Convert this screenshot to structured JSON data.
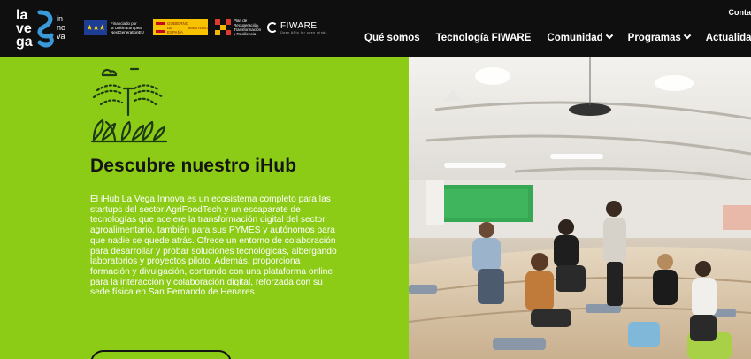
{
  "brand": {
    "logo_words": [
      "la",
      "ve",
      "ga"
    ],
    "logo_small": [
      "in",
      "no",
      "va"
    ]
  },
  "sponsors": {
    "eu_text": [
      "Financiado por",
      "la Unión Europea",
      "NextGenerationEU"
    ],
    "gov_text": "GOBIERNO DE ESPAÑA",
    "ministry_text": "MINISTERIO",
    "prtr_text": [
      "Plan de",
      "Recuperación,",
      "Transformación",
      "y Resiliencia"
    ],
    "fiware_text": "FIWARE",
    "fiware_sub": "Open APIs for open minds"
  },
  "header": {
    "contact": "Conta",
    "nav": [
      {
        "label": "Qué somos",
        "dropdown": false
      },
      {
        "label": "Tecnología FIWARE",
        "dropdown": false
      },
      {
        "label": "Comunidad",
        "dropdown": true
      },
      {
        "label": "Programas",
        "dropdown": true
      },
      {
        "label": "Actualidad",
        "dropdown": false
      }
    ]
  },
  "hero": {
    "title": "Descubre nuestro iHub",
    "body": "El iHub La Vega Innova es un ecosistema completo para las startups del sector AgriFoodTech y un escaparate de tecnologías que acelere la transformación digital del sector agroalimentario, también para sus PYMES y autónomos para que nadie se quede atrás. Ofrece un entorno de colaboración para desarrollar y probar soluciones tecnológicas, albergando laboratorios y proyectos piloto. Además, proporciona formación y divulgación, contando con una plataforma online para la interacción y colaboración digital, reforzada con su sede física en San Fernando de Henares.",
    "icon": "smart-irrigation-icon",
    "photo": "coworking-space-photo"
  },
  "colors": {
    "header_bg": "#0f0f0f",
    "panel_green": "#8ccc17",
    "logo_blue": "#3a9ad9",
    "title_text": "#141414"
  }
}
